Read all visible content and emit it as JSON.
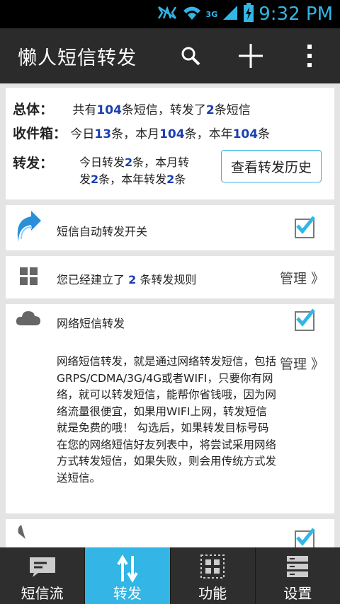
{
  "status_bar": {
    "time": "9:32 PM",
    "network": "3G"
  },
  "action_bar": {
    "title": "懒人短信转发",
    "icons": [
      "search-icon",
      "add-icon",
      "overflow-menu-icon"
    ]
  },
  "summary": {
    "total_label": "总体：",
    "total_prefix": "共有",
    "total_count": "104",
    "total_mid": "条短信，转发了",
    "forwarded_count": "2",
    "total_suffix": "条短信",
    "inbox_label": "收件箱：",
    "inbox_today_prefix": "今日",
    "inbox_today": "13",
    "inbox_today_suffix": "条，本月",
    "inbox_month": "104",
    "inbox_month_suffix": "条，本年",
    "inbox_year": "104",
    "inbox_year_suffix": "条",
    "forward_label": "转发：",
    "fw_line1_prefix": "今日转发",
    "fw_today": "2",
    "fw_line1_suffix": "条，本月转",
    "fw_line2_prefix": "发",
    "fw_month": "2",
    "fw_line2_mid": "条，本年转发",
    "fw_year": "2",
    "fw_line2_suffix": "条",
    "history_button": "查看转发历史"
  },
  "auto_forward": {
    "label": "短信自动转发开关",
    "checked": true
  },
  "rules": {
    "prefix": "您已经建立了 ",
    "count": "2",
    "suffix": " 条转发规则",
    "manage": "管理 》"
  },
  "network_forward": {
    "label": "网络短信转发",
    "checked": true,
    "manage": "管理 》",
    "description": "网络短信转发，就是通过网络转发短信，包括GRPS/CDMA/3G/4G或者WIFI，只要你有网络，就可以转发短信，能帮你省钱哦，因为网络流量很便宜，如果用WIFI上网，转发短信就是免费的哦！ 勾选后，如果转发目标号码在您的网络短信好友列表中，将尝试采用网络方式转发短信，如果失败，则会用传统方式发送短信。"
  },
  "bottom_nav": {
    "items": [
      {
        "label": "短信流",
        "icon": "message-icon",
        "active": false
      },
      {
        "label": "转发",
        "icon": "transfer-arrows-icon",
        "active": true
      },
      {
        "label": "功能",
        "icon": "grid-icon",
        "active": false
      },
      {
        "label": "设置",
        "icon": "settings-list-icon",
        "active": false
      }
    ]
  },
  "colors": {
    "accent": "#33b5e5",
    "number": "#1a3fb0",
    "actionbar": "#2b2b2b"
  }
}
